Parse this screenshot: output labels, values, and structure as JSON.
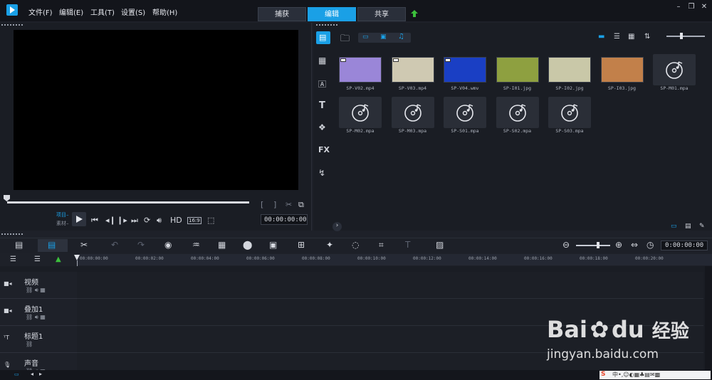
{
  "menu": {
    "file": "文件(F)",
    "edit": "编辑(E)",
    "tools": "工具(T)",
    "settings": "设置(S)",
    "help": "帮助(H)"
  },
  "tabs": {
    "capture": "捕获",
    "edit": "编辑",
    "share": "共享"
  },
  "player": {
    "project_label": "项目–",
    "clip_label": "素材–",
    "quality": "HD",
    "ratio": "16:9",
    "timecode": "00:00:00:00"
  },
  "library": {
    "items": [
      {
        "name": "SP-V02.mp4",
        "kind": "video",
        "color": "#9a86d8"
      },
      {
        "name": "SP-V03.mp4",
        "kind": "video",
        "color": "#cfc9b2"
      },
      {
        "name": "SP-V04.wmv",
        "kind": "video",
        "color": "#1a3fc4"
      },
      {
        "name": "SP-I01.jpg",
        "kind": "image",
        "color": "#8ea040"
      },
      {
        "name": "SP-I02.jpg",
        "kind": "image",
        "color": "#c9c8a8"
      },
      {
        "name": "SP-I03.jpg",
        "kind": "image",
        "color": "#c2804a"
      },
      {
        "name": "SP-M01.mpa",
        "kind": "audio"
      },
      {
        "name": "SP-M02.mpa",
        "kind": "audio"
      },
      {
        "name": "SP-M03.mpa",
        "kind": "audio"
      },
      {
        "name": "SP-S01.mpa",
        "kind": "audio"
      },
      {
        "name": "SP-S02.mpa",
        "kind": "audio"
      },
      {
        "name": "SP-S03.mpa",
        "kind": "audio"
      }
    ]
  },
  "timeline": {
    "timecode": "0:00:00:00",
    "ticks": [
      "00:00:00:00",
      "00:00:02:00",
      "00:00:04:00",
      "00:00:06:00",
      "00:00:08:00",
      "00:00:10:00",
      "00:00:12:00",
      "00:00:14:00",
      "00:00:16:00",
      "00:00:18:00",
      "00:00:20:00"
    ],
    "tracks": [
      {
        "name": "视频"
      },
      {
        "name": "叠加1"
      },
      {
        "name": "标题1"
      },
      {
        "name": "声音"
      }
    ]
  },
  "watermark": {
    "brand": "Bai",
    "brand2": "du",
    "sub": "经验",
    "url": "jingyan.baidu.com"
  },
  "colors": {
    "accent": "#1aa0e6",
    "menubar": "#13151b"
  }
}
